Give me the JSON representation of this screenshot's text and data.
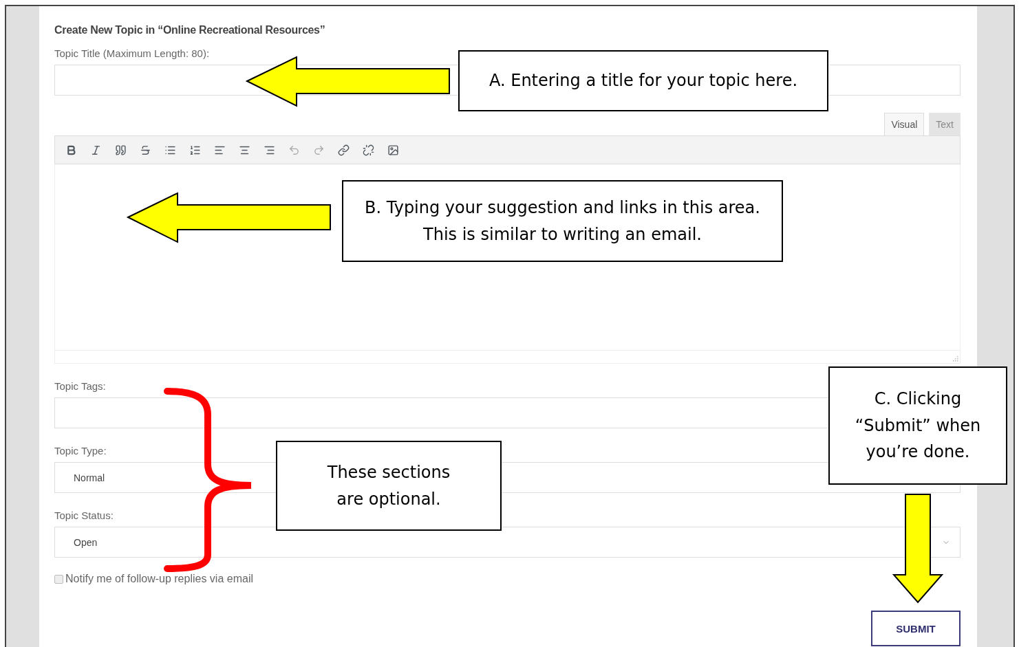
{
  "heading": "Create New Topic in “Online Recreational Resources”",
  "title_field": {
    "label": "Topic Title (Maximum Length: 80):"
  },
  "editor": {
    "tabs": [
      {
        "label": "Visual",
        "selected": true
      },
      {
        "label": "Text",
        "selected": false
      }
    ],
    "toolbar": [
      {
        "kind": "bold",
        "disabled": false
      },
      {
        "kind": "italic",
        "disabled": false
      },
      {
        "kind": "quote",
        "disabled": false
      },
      {
        "kind": "strike",
        "disabled": false
      },
      {
        "kind": "bullets",
        "disabled": false
      },
      {
        "kind": "numbers",
        "disabled": false
      },
      {
        "kind": "align-left",
        "disabled": false
      },
      {
        "kind": "align-center",
        "disabled": false
      },
      {
        "kind": "align-right",
        "disabled": false
      },
      {
        "kind": "undo",
        "disabled": true
      },
      {
        "kind": "redo",
        "disabled": true
      },
      {
        "kind": "link",
        "disabled": false
      },
      {
        "kind": "unlink",
        "disabled": false
      },
      {
        "kind": "image",
        "disabled": false
      }
    ]
  },
  "tags_field": {
    "label": "Topic Tags:"
  },
  "type_select": {
    "label": "Topic Type:",
    "value": "Normal"
  },
  "status_select": {
    "label": "Topic Status:",
    "value": "Open"
  },
  "notify": {
    "label": "Notify me of follow-up replies via email",
    "checked": false
  },
  "submit": {
    "label": "SUBMIT"
  },
  "callouts": [
    {
      "lines": [
        "A. Entering a title for your topic here."
      ]
    },
    {
      "lines": [
        "B. Typing your suggestion and links in this area.",
        "This is similar to writing an email."
      ]
    },
    {
      "lines": [
        "These sections",
        "are optional."
      ]
    },
    {
      "lines": [
        "C. Clicking",
        "“Submit” when",
        "you’re done."
      ]
    }
  ]
}
